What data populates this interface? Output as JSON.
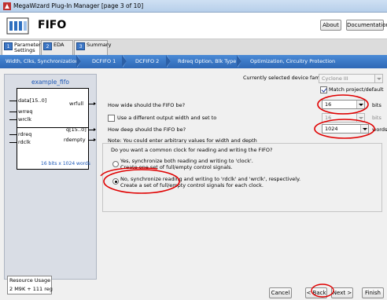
{
  "window": {
    "title": "MegaWizard Plug-In Manager [page 3 of 10]"
  },
  "header": {
    "title": "FIFO",
    "about_label": "About",
    "doc_label": "Documentation"
  },
  "page_tabs": [
    {
      "num": "1",
      "line1": "Parameter",
      "line2": "Settings"
    },
    {
      "num": "2",
      "line1": "EDA",
      "line2": ""
    },
    {
      "num": "3",
      "line1": "Summary",
      "line2": ""
    }
  ],
  "nav": [
    "Width, Clks, Synchronization",
    "DCFIFO 1",
    "DCFIFO 2",
    "Rdreq Option, Blk Type",
    "Optimization, Circuitry Protection"
  ],
  "schematic": {
    "title": "example_fifo",
    "inputs_top": [
      "data[15..0]",
      "wrreq",
      "wrclk"
    ],
    "output_top": "wrfull",
    "inputs_bottom": [
      "rdreq",
      "rdclk"
    ],
    "outputs_bottom": [
      "q[15..0]",
      "rdempty"
    ],
    "footer": "16 bits x 1024 words"
  },
  "resource": {
    "label": "Resource Usage",
    "value": "2 M9K + 111 reg"
  },
  "device": {
    "label": "Currently selected device family:",
    "value": "Cyclone III",
    "match_label": "Match project/default",
    "match_checked": true
  },
  "width": {
    "question": "How wide should the FIFO be?",
    "value": "16",
    "unit": "bits"
  },
  "diff_width": {
    "label": "Use a different output width and set to",
    "value": "16",
    "unit": "bits"
  },
  "depth": {
    "question": "How deep should the FIFO be?",
    "value": "1024",
    "unit": "words"
  },
  "note": "Note: You could enter arbitrary values for width and depth",
  "clock": {
    "question": "Do you want a common clock for reading and writing the FIFO?",
    "option1_line1": "Yes, synchronize both reading and writing to 'clock'.",
    "option1_line2": "Create one set of full/empty control signals.",
    "option2_line1": "No, synchronize reading and writing to 'rdclk' and 'wrclk', respectively.",
    "option2_line2": "Create a set of full/empty control signals for each clock.",
    "selected": 2
  },
  "buttons": {
    "cancel": "Cancel",
    "back": "< Back",
    "next": "Next >",
    "finish": "Finish"
  }
}
